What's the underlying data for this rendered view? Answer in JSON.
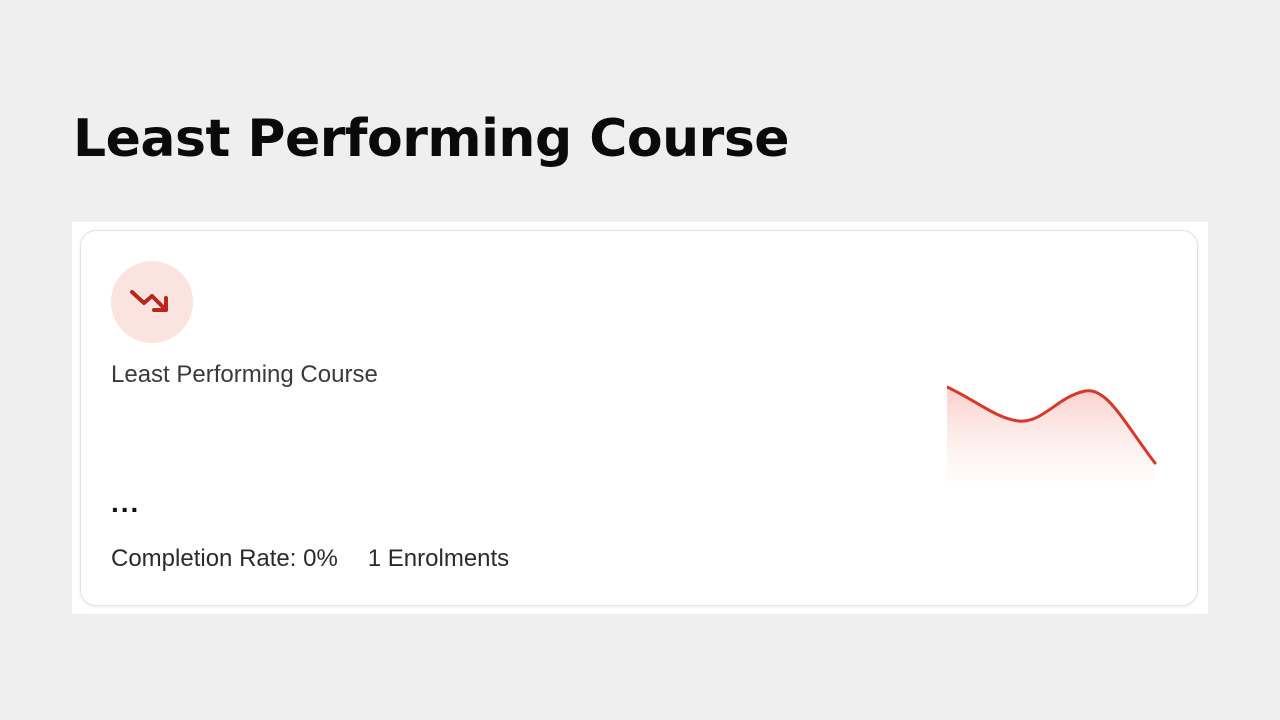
{
  "page": {
    "title": "Least Performing Course"
  },
  "card": {
    "icon": "trending-down-icon",
    "label": "Least Performing Course",
    "course_name": "...",
    "completion_rate": "Completion Rate: 0%",
    "enrolments": "1 Enrolments",
    "colors": {
      "accent": "#d9372a",
      "badge_background": "#fbe3df"
    }
  }
}
